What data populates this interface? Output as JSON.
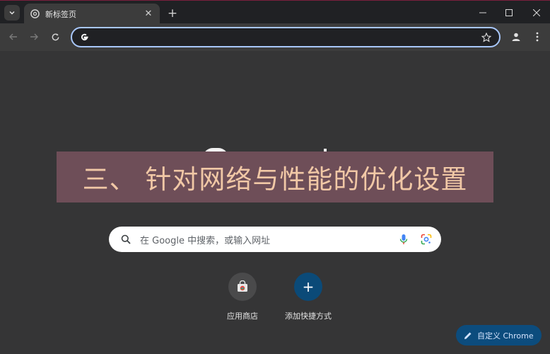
{
  "window": {
    "tab_title": "新标签页",
    "tab_close_icon": "close-icon",
    "new_tab_icon": "plus-icon"
  },
  "toolbar": {
    "address_value": "",
    "back_icon": "arrow-left-icon",
    "forward_icon": "arrow-right-icon",
    "reload_icon": "reload-icon",
    "bookmark_icon": "star-icon",
    "profile_icon": "person-icon",
    "menu_icon": "kebab-menu-icon"
  },
  "banner": {
    "text": "三、 针对网络与性能的优化设置"
  },
  "search": {
    "placeholder": "在 Google 中搜索，或输入网址"
  },
  "shortcuts": [
    {
      "label": "应用商店",
      "icon": "chrome-web-store-icon"
    },
    {
      "label": "添加快捷方式",
      "icon": "plus-icon"
    }
  ],
  "customize": {
    "label": "自定义 Chrome",
    "icon": "pencil-icon"
  },
  "colors": {
    "omnibox_focus_ring": "#a8c7fa",
    "banner_bg": "#6e4e58",
    "banner_text": "#f1c8a6",
    "accent_blue": "#0b4a78"
  }
}
